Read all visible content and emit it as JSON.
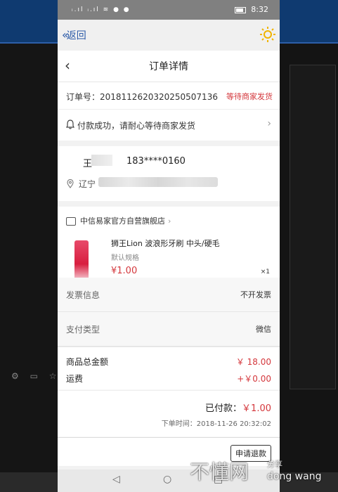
{
  "statusbar": {
    "signal_icons": "ᵢ.ıl ᵢ.ıl ≋ ● ●",
    "time": "8:32"
  },
  "appbar": {
    "back_label": "返回"
  },
  "nav": {
    "title": "订单详情"
  },
  "order": {
    "number_label": "订单号：20181126203202505071 36",
    "number_display": "订单号：201811262032025050713 6",
    "number": "订单号：20181126203202505071 36",
    "status": "等待商家发货"
  },
  "order_clean": {
    "number_text": "订单号：2018112620320250507136",
    "status": "等待商家发货"
  },
  "notice": {
    "text": "付款成功，请耐心等待商家发货"
  },
  "address": {
    "name": "王",
    "phone": "183****0160",
    "region": "辽宁"
  },
  "shop": {
    "name": "中信易家官方自营旗舰店"
  },
  "product": {
    "name": "狮王Lion 波浪形牙刷 中头/硬毛",
    "spec": "默认规格",
    "price": "¥1.00",
    "qty": "×1"
  },
  "invoice": {
    "label": "发票信息",
    "value": "不开发票"
  },
  "payment": {
    "label": "支付类型",
    "value": "微信"
  },
  "amounts": {
    "goods_label": "商品总金额",
    "goods_value": "￥ 18.00",
    "shipping_label": "运费",
    "shipping_value": "+￥0.00"
  },
  "paid": {
    "label": "已付款：",
    "value": "￥1.00",
    "time": "下单时间：2018-11-26 20:32:02"
  },
  "refund": {
    "label": "申请退款"
  },
  "watermark": {
    "big": "不懂网",
    "small": "分享",
    "latin": "dong wang"
  }
}
